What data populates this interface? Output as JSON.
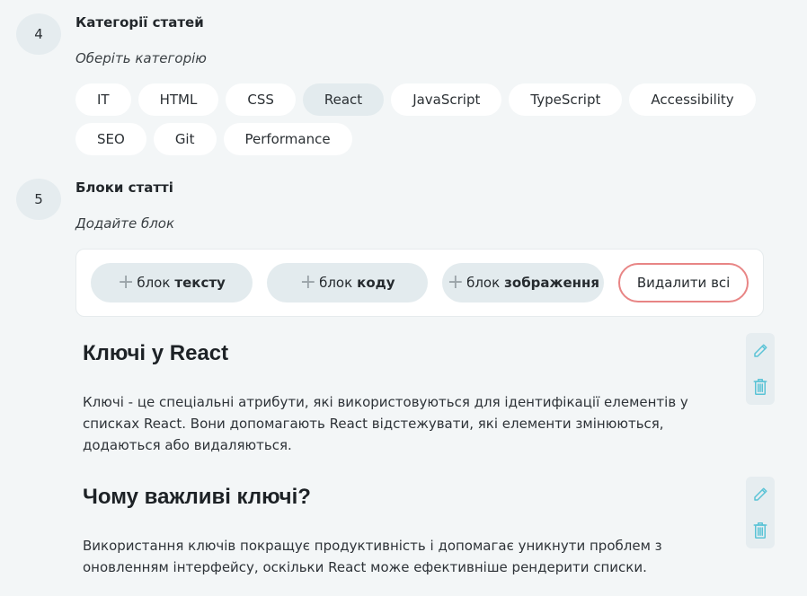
{
  "step4": {
    "number": "4",
    "title": "Категорії статей",
    "hint": "Оберіть категорію",
    "categories_row1": [
      "IT",
      "HTML",
      "CSS",
      "React",
      "JavaScript",
      "TypeScript",
      "Accessibility"
    ],
    "categories_row2": [
      "SEO",
      "Git",
      "Performance"
    ],
    "selected": "React"
  },
  "step5": {
    "number": "5",
    "title": "Блоки статті",
    "hint": "Додайте блок",
    "add_text": {
      "prefix": "блок",
      "word": "тексту"
    },
    "add_code": {
      "prefix": "блок",
      "word": "коду"
    },
    "add_image": {
      "prefix": "блок",
      "word": "зображення"
    },
    "delete_all": "Видалити всі"
  },
  "blocks": [
    {
      "heading": "Ключі у React",
      "text": "Ключі - це спеціальні атрибути, які використовуються для ідентифікації елементів у списках React. Вони допомагають React відстежувати, які елементи змінюються, додаються або видаляються."
    },
    {
      "heading": "Чому важливі ключі?",
      "text": "Використання ключів покращує продуктивність і допомагає уникнути проблем з оновленням інтерфейсу, оскільки React може ефективніше рендерити списки."
    }
  ],
  "colors": {
    "background": "#f3f6f7",
    "chip_active": "#e3ebee",
    "delete_border": "#e88585",
    "tool_icon": "#5ac3d6"
  },
  "icons": [
    "plus-icon",
    "pencil-icon",
    "trash-icon"
  ]
}
